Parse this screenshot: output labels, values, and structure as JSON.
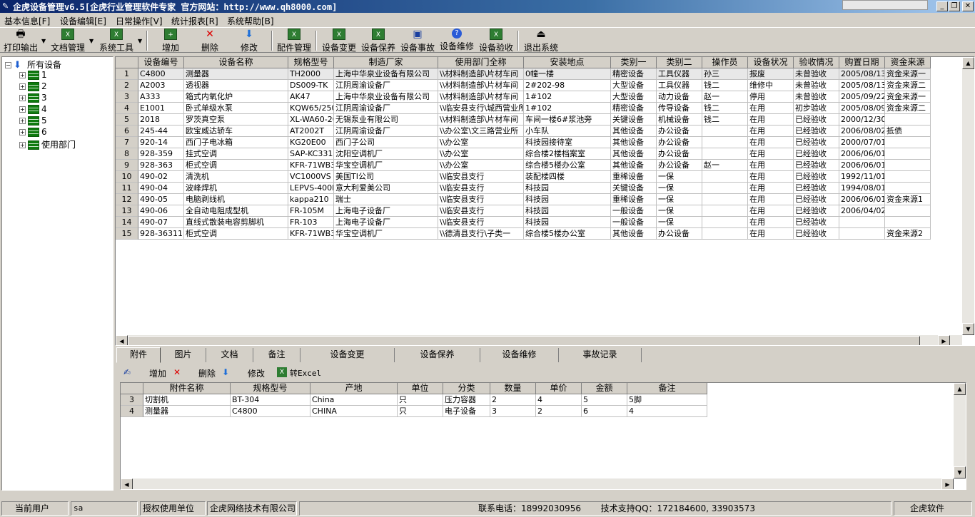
{
  "window": {
    "title": "企虎设备管理v6.5[企虎行业管理软件专家 官方网站：http://www.qh8000.com]",
    "controls": [
      "_",
      "❐",
      "✕"
    ]
  },
  "menubar": [
    "基本信息[F]",
    "设备编辑[E]",
    "日常操作[V]",
    "统计报表[R]",
    "系统帮助[B]"
  ],
  "toolbar": {
    "print": "打印输出",
    "docs": "文档管理",
    "tools": "系统工具",
    "add": "增加",
    "delete": "删除",
    "modify": "修改",
    "parts": "配件管理",
    "change": "设备变更",
    "maintain": "设备保养",
    "accident": "设备事故",
    "repair": "设备维修",
    "accept": "设备验收",
    "exit": "退出系统"
  },
  "tree": {
    "root": "所有设备",
    "children": [
      "1",
      "2",
      "3",
      "4",
      "5",
      "6",
      "使用部门"
    ]
  },
  "grid": {
    "columns": [
      "设备编号",
      "设备名称",
      "规格型号",
      "制造厂家",
      "使用部门全称",
      "安装地点",
      "类别一",
      "类别二",
      "操作员",
      "设备状况",
      "验收情况",
      "购置日期",
      "资金来源"
    ],
    "rows": [
      [
        "1",
        "C4800",
        "测量器",
        "TH2000",
        "上海中华泉业设备有限公司",
        "\\\\材料制造部\\片材车间",
        "0幢一楼",
        "精密设备",
        "工具仪器",
        "孙三",
        "报废",
        "未曾验收",
        "2005/08/13",
        "资金来源一"
      ],
      [
        "2",
        "A2003",
        "透视器",
        "DS009-TK",
        "江阴周渝设备厂",
        "\\\\材料制造部\\片材车间",
        "2#202-98",
        "大型设备",
        "工具仪器",
        "钱二",
        "维修中",
        "未曾验收",
        "2005/08/13",
        "资金来源二"
      ],
      [
        "3",
        "A333",
        "箱式内氧化炉",
        "AK47",
        "上海中华泉业设备有限公司",
        "\\\\材料制造部\\片材车间",
        "1#102",
        "大型设备",
        "动力设备",
        "赵一",
        "停用",
        "未曾验收",
        "2005/09/22",
        "资金来源一"
      ],
      [
        "4",
        "E1001",
        "卧式单级水泵",
        "KQW65/250",
        "江阴周渝设备厂",
        "\\\\临安县支行\\城西营业所",
        "1#102",
        "精密设备",
        "传导设备",
        "钱二",
        "在用",
        "初步验收",
        "2005/08/09",
        "资金来源二"
      ],
      [
        "5",
        "2018",
        "罗茨真空泵",
        "XL-WA60-20",
        "无锡泵业有限公司",
        "\\\\材料制造部\\片材车间",
        "车间一楼6#浆池旁",
        "关键设备",
        "机械设备",
        "钱二",
        "在用",
        "已经验收",
        "2000/12/30",
        ""
      ],
      [
        "6",
        "245-44",
        "欧宝威达轿车",
        "AT2002T",
        "江阴周渝设备厂",
        "\\\\办公室\\文三路营业所",
        "小车队",
        "其他设备",
        "办公设备",
        "",
        "在用",
        "已经验收",
        "2006/08/02",
        "抵债"
      ],
      [
        "7",
        "920-14",
        "西门子电冰箱",
        "KG20E00",
        "西门子公司",
        "\\\\办公室",
        "科技园接待室",
        "其他设备",
        "办公设备",
        "",
        "在用",
        "已经验收",
        "2000/07/01",
        ""
      ],
      [
        "8",
        "928-359",
        "挂式空调",
        "SAP-KC331C",
        "沈阳空调机厂",
        "\\\\办公室",
        "综合楼2楼档案室",
        "其他设备",
        "办公设备",
        "",
        "在用",
        "已经验收",
        "2006/06/01",
        ""
      ],
      [
        "9",
        "928-363",
        "柜式空调",
        "KFR-71WB3S",
        "华宝空调机厂",
        "\\\\办公室",
        "综合楼5楼办公室",
        "其他设备",
        "办公设备",
        "赵一",
        "在用",
        "已经验收",
        "2006/06/01",
        ""
      ],
      [
        "10",
        "490-02",
        "清洗机",
        "VC1000VS",
        "美国TI公司",
        "\\\\临安县支行",
        "装配楼四楼",
        "重稀设备",
        "一保",
        "",
        "在用",
        "已经验收",
        "1992/11/01",
        ""
      ],
      [
        "11",
        "490-04",
        "波峰焊机",
        "LEPVS-400F",
        "意大利爱美公司",
        "\\\\临安县支行",
        "科技园",
        "关键设备",
        "一保",
        "",
        "在用",
        "已经验收",
        "1994/08/01",
        ""
      ],
      [
        "12",
        "490-05",
        "电脑剥线机",
        "kappa210",
        "瑞士",
        "\\\\临安县支行",
        "科技园",
        "重稀设备",
        "一保",
        "",
        "在用",
        "已经验收",
        "2006/06/01",
        "资金来源1"
      ],
      [
        "13",
        "490-06",
        "全自动电阻成型机",
        "FR-105M",
        "上海电子设备厂",
        "\\\\临安县支行",
        "科技园",
        "一般设备",
        "一保",
        "",
        "在用",
        "已经验收",
        "2006/04/02",
        ""
      ],
      [
        "14",
        "490-07",
        "直线式散装电容剪脚机",
        "FR-103",
        "上海电子设备厂",
        "\\\\临安县支行",
        "科技园",
        "一般设备",
        "一保",
        "",
        "在用",
        "已经验收",
        "",
        ""
      ],
      [
        "15",
        "928-3631112",
        "柜式空调",
        "KFR-71WB3S",
        "华宝空调机厂",
        "\\\\德清县支行\\子类一",
        "综合楼5楼办公室",
        "其他设备",
        "办公设备",
        "",
        "在用",
        "已经验收",
        "",
        "资金来源2"
      ]
    ]
  },
  "tabs": [
    "附件",
    "图片",
    "文档",
    "备注",
    "设备变更",
    "设备保养",
    "设备维修",
    "事故记录"
  ],
  "subtoolbar": {
    "add": "增加",
    "delete": "删除",
    "modify": "修改",
    "excel": "转Excel"
  },
  "subgrid": {
    "columns": [
      "附件名称",
      "规格型号",
      "产地",
      "单位",
      "分类",
      "数量",
      "单价",
      "金额",
      "备注"
    ],
    "rows": [
      [
        "3",
        "切割机",
        "BT-304",
        "China",
        "只",
        "压力容器",
        "2",
        "4",
        "5",
        "5脚"
      ],
      [
        "4",
        "测量器",
        "C4800",
        "CHINA",
        "只",
        "电子设备",
        "3",
        "2",
        "6",
        "4"
      ]
    ]
  },
  "statusbar": {
    "user_label": "当前用户",
    "user": "sa",
    "license_label": "授权使用单位",
    "license": "企虎网络技术有限公司",
    "phone": "联系电话：18992030956",
    "qq": "技术支持QQ：172184600, 33903573",
    "brand": "企虎软件"
  }
}
